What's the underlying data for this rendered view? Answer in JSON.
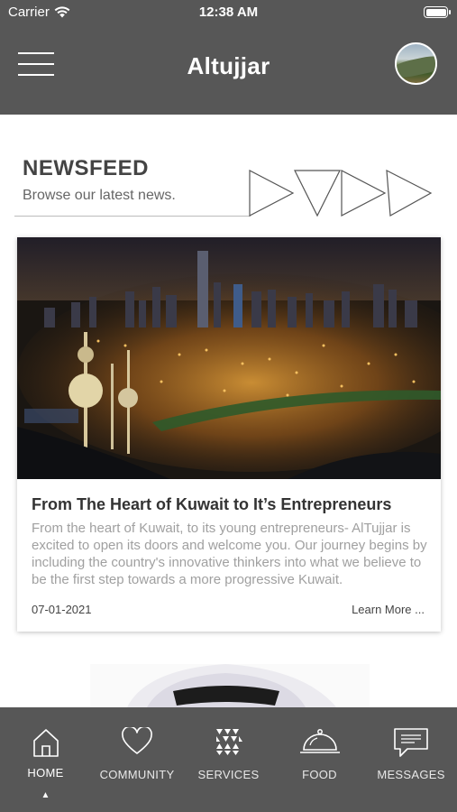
{
  "status_bar": {
    "carrier": "Carrier",
    "time": "12:38 AM"
  },
  "header": {
    "title": "Altujjar",
    "menu_icon": "hamburger-icon",
    "avatar_icon": "profile-avatar"
  },
  "newsfeed": {
    "title": "NEWSFEED",
    "subtitle": "Browse our latest news."
  },
  "post": {
    "image_alt": "Kuwait City skyline at night with Kuwait Towers",
    "title": "From The Heart of Kuwait to It’s Entrepreneurs",
    "body": "From the heart of Kuwait, to its young entrepreneurs- AlTujjar is excited to open its doors and welcome you. Our journey begins by including the country's innovative thinkers into what we believe to be the first step towards a more progressive Kuwait.",
    "date": "07-01-2021",
    "more_label": "Learn More ..."
  },
  "tabs": [
    {
      "label": "HOME",
      "icon": "home-icon",
      "active": true
    },
    {
      "label": "COMMUNITY",
      "icon": "heart-icon",
      "active": false
    },
    {
      "label": "SERVICES",
      "icon": "triangles-grid-icon",
      "active": false
    },
    {
      "label": "FOOD",
      "icon": "cloche-icon",
      "active": false
    },
    {
      "label": "MESSAGES",
      "icon": "chat-bubble-icon",
      "active": false
    }
  ],
  "colors": {
    "header_bg": "#575757",
    "tabbar_bg": "#575757",
    "text_dark": "#333333",
    "text_muted": "#a0a0a0"
  }
}
